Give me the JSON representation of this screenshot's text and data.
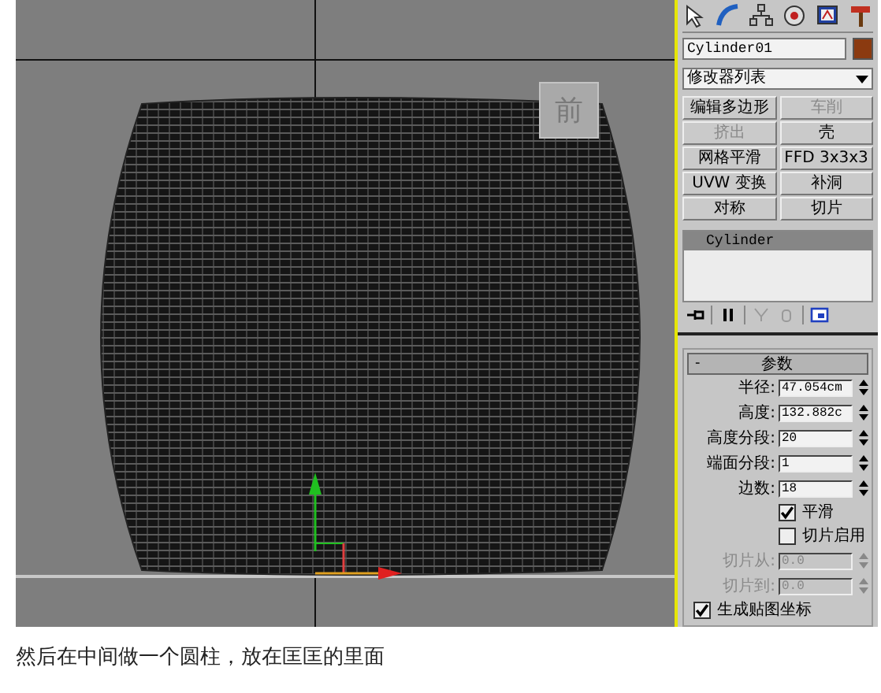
{
  "viewport": {
    "viewcube_label": "前"
  },
  "command_panel": {
    "object_name": "Cylinder01",
    "color": "#8b3a10",
    "modifier_list": "修改器列表",
    "modifier_buttons": [
      {
        "label": "编辑多边形",
        "disabled": false
      },
      {
        "label": "车削",
        "disabled": true
      },
      {
        "label": "挤出",
        "disabled": true
      },
      {
        "label": "壳",
        "disabled": false
      },
      {
        "label": "网格平滑",
        "disabled": false
      },
      {
        "label": "FFD 3x3x3",
        "disabled": false
      },
      {
        "label": "UVW 变换",
        "disabled": false
      },
      {
        "label": "补洞",
        "disabled": false
      },
      {
        "label": "对称",
        "disabled": false
      },
      {
        "label": "切片",
        "disabled": false
      }
    ],
    "stack": [
      {
        "label": "Cylinder",
        "selected": true
      }
    ],
    "rollout": {
      "collapse_symbol": "-",
      "title": "参数",
      "params": [
        {
          "kind": "spinner",
          "label": "半径:",
          "value": "47.054cm",
          "disabled": false
        },
        {
          "kind": "spinner",
          "label": "高度:",
          "value": "132.882c",
          "disabled": false
        },
        {
          "kind": "spinner",
          "label": "高度分段:",
          "value": "20",
          "disabled": false
        },
        {
          "kind": "spinner",
          "label": "端面分段:",
          "value": "1",
          "disabled": false
        },
        {
          "kind": "spinner",
          "label": "边数:",
          "value": "18",
          "disabled": false
        },
        {
          "kind": "checkbox",
          "label": "平滑",
          "checked": true
        },
        {
          "kind": "checkbox",
          "label": "切片启用",
          "checked": false
        },
        {
          "kind": "spinner",
          "label": "切片从:",
          "value": "0.0",
          "disabled": true
        },
        {
          "kind": "spinner",
          "label": "切片到:",
          "value": "0.0",
          "disabled": true
        }
      ],
      "map_options": [
        {
          "label": "生成贴图坐标",
          "checked": true
        }
      ]
    }
  },
  "caption": "然后在中间做一个圆柱，放在匡匡的里面"
}
